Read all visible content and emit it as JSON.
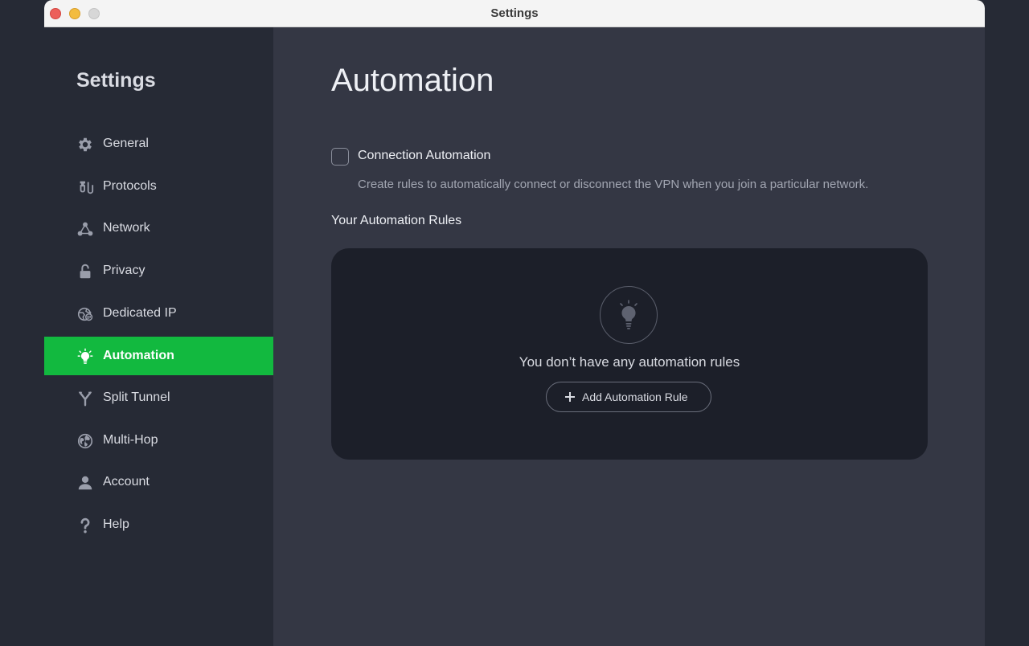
{
  "window": {
    "title": "Settings"
  },
  "sidebar": {
    "title": "Settings",
    "items": [
      {
        "label": "General",
        "icon": "gear-icon",
        "active": false
      },
      {
        "label": "Protocols",
        "icon": "protocols-icon",
        "active": false
      },
      {
        "label": "Network",
        "icon": "network-icon",
        "active": false
      },
      {
        "label": "Privacy",
        "icon": "lock-icon",
        "active": false
      },
      {
        "label": "Dedicated IP",
        "icon": "dedicated-ip-icon",
        "active": false
      },
      {
        "label": "Automation",
        "icon": "lightbulb-icon",
        "active": true
      },
      {
        "label": "Split Tunnel",
        "icon": "split-tunnel-icon",
        "active": false
      },
      {
        "label": "Multi-Hop",
        "icon": "globe-icon",
        "active": false
      },
      {
        "label": "Account",
        "icon": "person-icon",
        "active": false
      },
      {
        "label": "Help",
        "icon": "question-icon",
        "active": false
      }
    ]
  },
  "main": {
    "title": "Automation",
    "connection_automation": {
      "label": "Connection Automation",
      "checked": false,
      "description": "Create rules to automatically connect or disconnect the VPN when you join a particular network."
    },
    "rules_section": {
      "title": "Your Automation Rules",
      "empty_icon": "lightbulb-icon",
      "empty_text": "You don’t have any automation rules",
      "add_button_label": "Add Automation Rule",
      "add_button_icon": "plus-icon"
    }
  },
  "colors": {
    "accent": "#12b93f",
    "sidebar_bg": "#262a35",
    "main_bg": "#343744",
    "panel_bg": "#1c1f29"
  }
}
